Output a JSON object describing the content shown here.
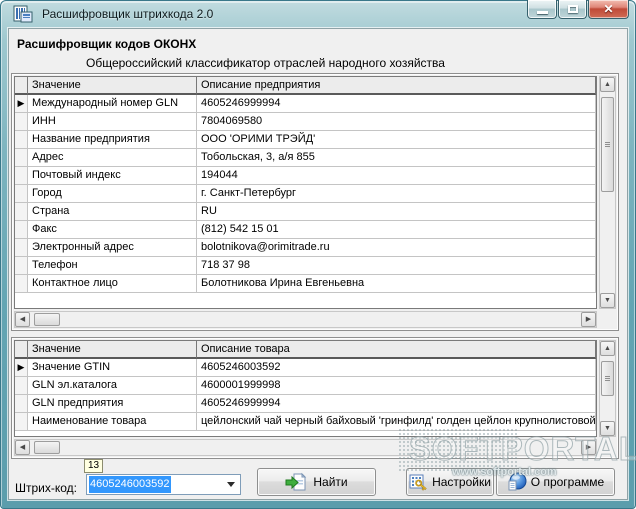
{
  "window": {
    "title": "Расшифровщик штрихкода 2.0"
  },
  "header": {
    "title": "Расшифровщик кодов ОКОНХ",
    "subtitle": "Общероссийский классификатор отраслей народного хозяйства"
  },
  "company_grid": {
    "columns": [
      "Значение",
      "Описание предприятия"
    ],
    "selected": 0,
    "rows": [
      {
        "label": "Международный номер GLN",
        "value": "4605246999994"
      },
      {
        "label": "ИНН",
        "value": "7804069580"
      },
      {
        "label": "Название предприятия",
        "value": "ООО 'ОРИМИ ТРЭЙД'"
      },
      {
        "label": "Адрес",
        "value": "Тобольская, 3, а/я 855"
      },
      {
        "label": "Почтовый индекс",
        "value": "194044"
      },
      {
        "label": "Город",
        "value": "г. Санкт-Петербург"
      },
      {
        "label": "Страна",
        "value": "RU"
      },
      {
        "label": "Факс",
        "value": "(812) 542 15 01"
      },
      {
        "label": "Электронный адрес",
        "value": "bolotnikova@orimitrade.ru"
      },
      {
        "label": "Телефон",
        "value": "718 37 98"
      },
      {
        "label": "Контактное лицо",
        "value": "Болотникова Ирина Евгеньевна"
      }
    ]
  },
  "product_grid": {
    "columns": [
      "Значение",
      "Описание товара"
    ],
    "selected": 0,
    "rows": [
      {
        "label": "Значение GTIN",
        "value": "4605246003592"
      },
      {
        "label": "GLN эл.каталога",
        "value": "4600001999998"
      },
      {
        "label": "GLN предприятия",
        "value": "4605246999994"
      },
      {
        "label": "Наименование товара",
        "value": "цейлонский чай черный байховый 'гринфилд' голден цейлон крупнолистовой"
      }
    ]
  },
  "footer": {
    "barcode_label": "Штрих-код:",
    "barcode_value": "4605246003592",
    "tooltip": "13",
    "find_button": "Найти",
    "settings_button": "Настройки",
    "about_button": "О программе"
  },
  "watermark": {
    "text": "SOFTPORTAL",
    "url": "www.softportal.com"
  },
  "colors": {
    "frame_teal": "#63a5b3",
    "selection_blue": "#3297fd",
    "tooltip_yellow": "#ffffe1",
    "close_button_red": "#c04a38",
    "client_gray": "#f0f0f0"
  }
}
